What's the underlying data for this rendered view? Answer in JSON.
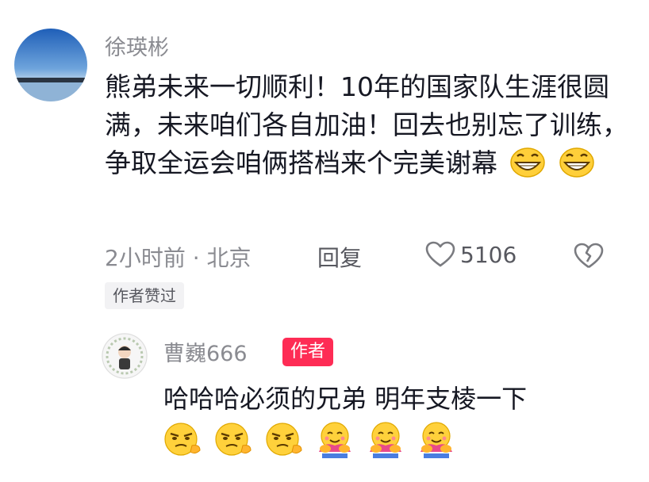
{
  "comment": {
    "username": "徐瑛彬",
    "text": "熊弟未来一切顺利！10年的国家队生涯很圆满，未来咱们各自加油！回去也别忘了训练，争取全运会咱俩搭档来个完美谢幕",
    "emojis": [
      "grin-emoji",
      "grin-emoji"
    ],
    "time_location": "2小时前 · 北京",
    "reply_label": "回复",
    "like_count": "5106",
    "author_liked_label": "作者赞过"
  },
  "reply": {
    "username": "曹巍666",
    "badge": "作者",
    "text": "哈哈哈必须的兄弟 明年支棱一下",
    "emojis": [
      "smirk-emoji",
      "smirk-emoji",
      "smirk-emoji",
      "hug-emoji",
      "hug-emoji",
      "hug-emoji"
    ]
  },
  "colors": {
    "accent_badge": "#fe2c55",
    "secondary_text": "#8a8b91",
    "primary_text": "#161823"
  }
}
